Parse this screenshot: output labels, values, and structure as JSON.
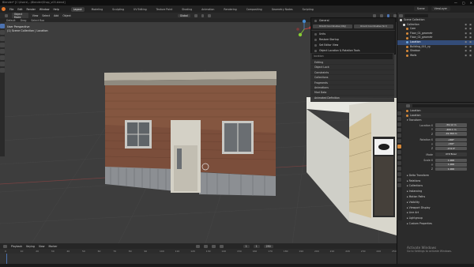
{
  "titlebar": {
    "title": "Blender* [C:\\Users\\...\\Blender\\Shop_v03.blend]",
    "controls": [
      "—",
      "▢",
      "✕"
    ]
  },
  "menubar": {
    "items": [
      "File",
      "Edit",
      "Render",
      "Window",
      "Help"
    ],
    "workspaces": [
      "Layout",
      "Modeling",
      "Sculpting",
      "UV Editing",
      "Texture Paint",
      "Shading",
      "Animation",
      "Rendering",
      "Compositing",
      "Geometry Nodes",
      "Scripting"
    ],
    "active_workspace": "Layout",
    "scene": "Scene",
    "view_layer": "ViewLayer"
  },
  "viewport_header": {
    "mode": "Object Mode",
    "menus": [
      "View",
      "Select",
      "Add",
      "Object"
    ],
    "orientation": "Global",
    "sub_items": [
      "Default",
      "Drag",
      "Select Box"
    ]
  },
  "viewport_info": {
    "line1": "User Perspective",
    "line2": "(1) Scene Collection | Location"
  },
  "popup": {
    "header_items": [
      "General"
    ],
    "buttons": [
      "Orient Coordinates (Obj)",
      "Orient Coordinates (Scr)"
    ],
    "items": [
      "Units",
      "Restore Startup",
      "Set Editor View",
      "Object Location & Rotation Tools"
    ]
  },
  "overlay": {
    "search": "location",
    "items": [
      "Editing",
      "Object Lock",
      "Constraints",
      "Collections",
      "Fragments",
      "Animations",
      "Mod Data",
      "Animated Definition"
    ]
  },
  "timeline": {
    "header": [
      "Playback",
      "Keying",
      "View",
      "Marker"
    ],
    "ticks": [
      "0",
      "10",
      "20",
      "30",
      "40",
      "50",
      "60",
      "70",
      "80",
      "90",
      "100",
      "110",
      "120",
      "130",
      "140",
      "150",
      "160",
      "170",
      "180",
      "190",
      "200",
      "210",
      "220",
      "230",
      "240",
      "250"
    ],
    "current_frame": "1",
    "start": "1",
    "end": "250"
  },
  "outliner": {
    "title": "Scene Collection",
    "items": [
      {
        "label": "Collection",
        "depth": 0,
        "selected": false,
        "color": "#e7e7e7"
      },
      {
        "label": "Cam",
        "depth": 1,
        "selected": false,
        "color": "#d88a3a"
      },
      {
        "label": "Floor_01_geometr",
        "depth": 1,
        "selected": false,
        "color": "#d88a3a"
      },
      {
        "label": "Floor_02_geometr",
        "depth": 1,
        "selected": false,
        "color": "#d88a3a"
      },
      {
        "label": "Location",
        "depth": 1,
        "selected": true,
        "color": "#6fa8dc"
      },
      {
        "label": "Building_001_rg",
        "depth": 1,
        "selected": false,
        "color": "#d88a3a"
      },
      {
        "label": "Shadow",
        "depth": 1,
        "selected": false,
        "color": "#d88a3a"
      },
      {
        "label": "Walls",
        "depth": 1,
        "selected": false,
        "color": "#d88a3a"
      }
    ]
  },
  "properties": {
    "object_name": "Location",
    "panel_title": "Location",
    "transform_label": "Transform",
    "location_label": "Location X",
    "location": [
      "-59.12 m",
      "-400.1 m",
      "-19.369 m"
    ],
    "rotation_label": "Rotation X",
    "rotation": [
      "-180°",
      "-180°",
      "-172.5°"
    ],
    "mode_label": "Mode",
    "mode_value": "XYZ Euler",
    "scale_label": "Scale X",
    "scale": [
      "1.000",
      "1.000",
      "1.000"
    ],
    "sections": [
      "Delta Transform",
      "Relations",
      "Collections",
      "Instancing",
      "Motion Paths",
      "Visibility",
      "Viewport Display",
      "Line Art",
      "Lightgroup",
      "Custom Properties"
    ],
    "shading_label": "Shading"
  },
  "activation": {
    "line1": "Activate Windows",
    "line2": "Go to Settings to activate Windows."
  }
}
